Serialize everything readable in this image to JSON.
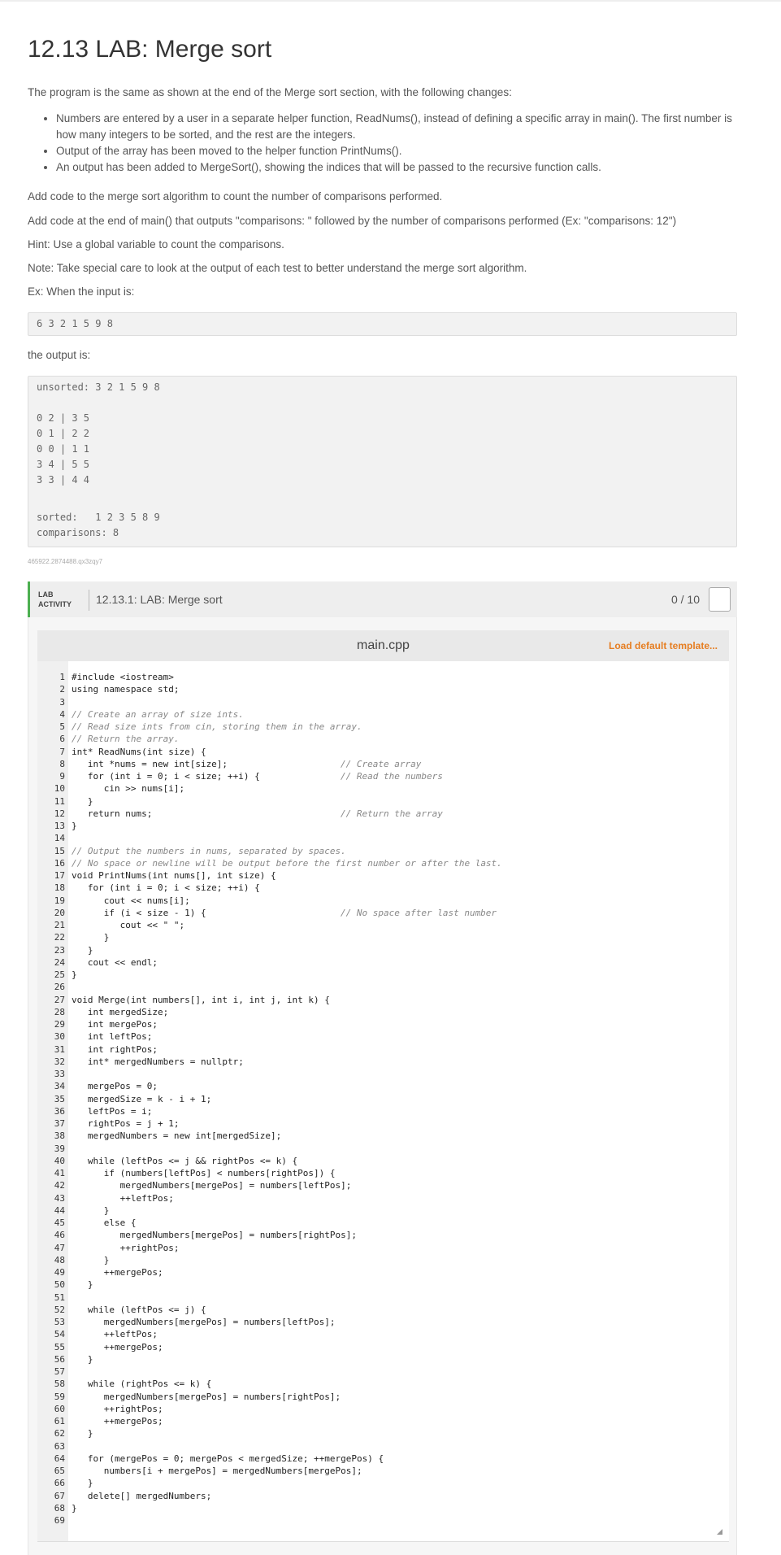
{
  "title": "12.13 LAB: Merge sort",
  "intro": "The program is the same as shown at the end of the Merge sort section, with the following changes:",
  "bullets": [
    "Numbers are entered by a user in a separate helper function, ReadNums(), instead of defining a specific array in main(). The first number is how many integers to be sorted, and the rest are the integers.",
    "Output of the array has been moved to the helper function PrintNums().",
    "An output has been added to MergeSort(), showing the indices that will be passed to the recursive function calls."
  ],
  "instructions": [
    "Add code to the merge sort algorithm to count the number of comparisons performed.",
    "Add code at the end of main() that outputs \"comparisons: \" followed by the number of comparisons performed (Ex: \"comparisons: 12\")",
    "Hint: Use a global variable to count the comparisons.",
    "Note: Take special care to look at the output of each test to better understand the merge sort algorithm.",
    "Ex: When the input is:"
  ],
  "example_input": "6 3 2 1 5 9 8",
  "output_label": "the output is:",
  "example_output": [
    "unsorted: 3 2 1 5 9 8",
    "",
    "0 2 | 3 5",
    "0 1 | 2 2",
    "0 0 | 1 1",
    "3 4 | 5 5",
    "3 3 | 4 4",
    "",
    "sorted:   1 2 3 5 8 9",
    "comparisons: 8"
  ],
  "small_id": "465922.2874488.qx3zqy7",
  "lab": {
    "tag_line1": "LAB",
    "tag_line2": "ACTIVITY",
    "title": "12.13.1: LAB: Merge sort",
    "score": "0 / 10",
    "file_name": "main.cpp",
    "load_template": "Load default template..."
  },
  "code_lines": [
    {
      "n": "1",
      "code": "#include <iostream>",
      "comment": ""
    },
    {
      "n": "2",
      "code": "using namespace std;",
      "comment": ""
    },
    {
      "n": "3",
      "code": "",
      "comment": ""
    },
    {
      "n": "4",
      "code": "// Create an array of size ints.",
      "comment": ""
    },
    {
      "n": "5",
      "code": "// Read size ints from cin, storing them in the array.",
      "comment": ""
    },
    {
      "n": "6",
      "code": "// Return the array.",
      "comment": ""
    },
    {
      "n": "7",
      "code": "int* ReadNums(int size) {",
      "comment": ""
    },
    {
      "n": "8",
      "code": "   int *nums = new int[size];",
      "comment": "// Create array"
    },
    {
      "n": "9",
      "code": "   for (int i = 0; i < size; ++i) {",
      "comment": "// Read the numbers"
    },
    {
      "n": "10",
      "code": "      cin >> nums[i];",
      "comment": ""
    },
    {
      "n": "11",
      "code": "   }",
      "comment": ""
    },
    {
      "n": "12",
      "code": "   return nums;",
      "comment": "// Return the array"
    },
    {
      "n": "13",
      "code": "}",
      "comment": ""
    },
    {
      "n": "14",
      "code": "",
      "comment": ""
    },
    {
      "n": "15",
      "code": "// Output the numbers in nums, separated by spaces.",
      "comment": ""
    },
    {
      "n": "16",
      "code": "// No space or newline will be output before the first number or after the last.",
      "comment": ""
    },
    {
      "n": "17",
      "code": "void PrintNums(int nums[], int size) {",
      "comment": ""
    },
    {
      "n": "18",
      "code": "   for (int i = 0; i < size; ++i) {",
      "comment": ""
    },
    {
      "n": "19",
      "code": "      cout << nums[i];",
      "comment": ""
    },
    {
      "n": "20",
      "code": "      if (i < size - 1) {",
      "comment": "// No space after last number"
    },
    {
      "n": "21",
      "code": "         cout << \" \";",
      "comment": ""
    },
    {
      "n": "22",
      "code": "      }",
      "comment": ""
    },
    {
      "n": "23",
      "code": "   }",
      "comment": ""
    },
    {
      "n": "24",
      "code": "   cout << endl;",
      "comment": ""
    },
    {
      "n": "25",
      "code": "}",
      "comment": ""
    },
    {
      "n": "26",
      "code": "",
      "comment": ""
    },
    {
      "n": "27",
      "code": "void Merge(int numbers[], int i, int j, int k) {",
      "comment": ""
    },
    {
      "n": "28",
      "code": "   int mergedSize;",
      "comment": ""
    },
    {
      "n": "29",
      "code": "   int mergePos;",
      "comment": ""
    },
    {
      "n": "30",
      "code": "   int leftPos;",
      "comment": ""
    },
    {
      "n": "31",
      "code": "   int rightPos;",
      "comment": ""
    },
    {
      "n": "32",
      "code": "   int* mergedNumbers = nullptr;",
      "comment": ""
    },
    {
      "n": "33",
      "code": "",
      "comment": ""
    },
    {
      "n": "34",
      "code": "   mergePos = 0;",
      "comment": ""
    },
    {
      "n": "35",
      "code": "   mergedSize = k - i + 1;",
      "comment": ""
    },
    {
      "n": "36",
      "code": "   leftPos = i;",
      "comment": ""
    },
    {
      "n": "37",
      "code": "   rightPos = j + 1;",
      "comment": ""
    },
    {
      "n": "38",
      "code": "   mergedNumbers = new int[mergedSize];",
      "comment": ""
    },
    {
      "n": "39",
      "code": "",
      "comment": ""
    },
    {
      "n": "40",
      "code": "   while (leftPos <= j && rightPos <= k) {",
      "comment": ""
    },
    {
      "n": "41",
      "code": "      if (numbers[leftPos] < numbers[rightPos]) {",
      "comment": ""
    },
    {
      "n": "42",
      "code": "         mergedNumbers[mergePos] = numbers[leftPos];",
      "comment": ""
    },
    {
      "n": "43",
      "code": "         ++leftPos;",
      "comment": ""
    },
    {
      "n": "44",
      "code": "      }",
      "comment": ""
    },
    {
      "n": "45",
      "code": "      else {",
      "comment": ""
    },
    {
      "n": "46",
      "code": "         mergedNumbers[mergePos] = numbers[rightPos];",
      "comment": ""
    },
    {
      "n": "47",
      "code": "         ++rightPos;",
      "comment": ""
    },
    {
      "n": "48",
      "code": "      }",
      "comment": ""
    },
    {
      "n": "49",
      "code": "      ++mergePos;",
      "comment": ""
    },
    {
      "n": "50",
      "code": "   }",
      "comment": ""
    },
    {
      "n": "51",
      "code": "",
      "comment": ""
    },
    {
      "n": "52",
      "code": "   while (leftPos <= j) {",
      "comment": ""
    },
    {
      "n": "53",
      "code": "      mergedNumbers[mergePos] = numbers[leftPos];",
      "comment": ""
    },
    {
      "n": "54",
      "code": "      ++leftPos;",
      "comment": ""
    },
    {
      "n": "55",
      "code": "      ++mergePos;",
      "comment": ""
    },
    {
      "n": "56",
      "code": "   }",
      "comment": ""
    },
    {
      "n": "57",
      "code": "",
      "comment": ""
    },
    {
      "n": "58",
      "code": "   while (rightPos <= k) {",
      "comment": ""
    },
    {
      "n": "59",
      "code": "      mergedNumbers[mergePos] = numbers[rightPos];",
      "comment": ""
    },
    {
      "n": "60",
      "code": "      ++rightPos;",
      "comment": ""
    },
    {
      "n": "61",
      "code": "      ++mergePos;",
      "comment": ""
    },
    {
      "n": "62",
      "code": "   }",
      "comment": ""
    },
    {
      "n": "63",
      "code": "",
      "comment": ""
    },
    {
      "n": "64",
      "code": "   for (mergePos = 0; mergePos < mergedSize; ++mergePos) {",
      "comment": ""
    },
    {
      "n": "65",
      "code": "      numbers[i + mergePos] = mergedNumbers[mergePos];",
      "comment": ""
    },
    {
      "n": "66",
      "code": "   }",
      "comment": ""
    },
    {
      "n": "67",
      "code": "   delete[] mergedNumbers;",
      "comment": ""
    },
    {
      "n": "68",
      "code": "}",
      "comment": ""
    },
    {
      "n": "69",
      "code": "",
      "comment": ""
    }
  ],
  "colors": {
    "accent_green": "#4caf50",
    "link_orange": "#e67e22"
  }
}
